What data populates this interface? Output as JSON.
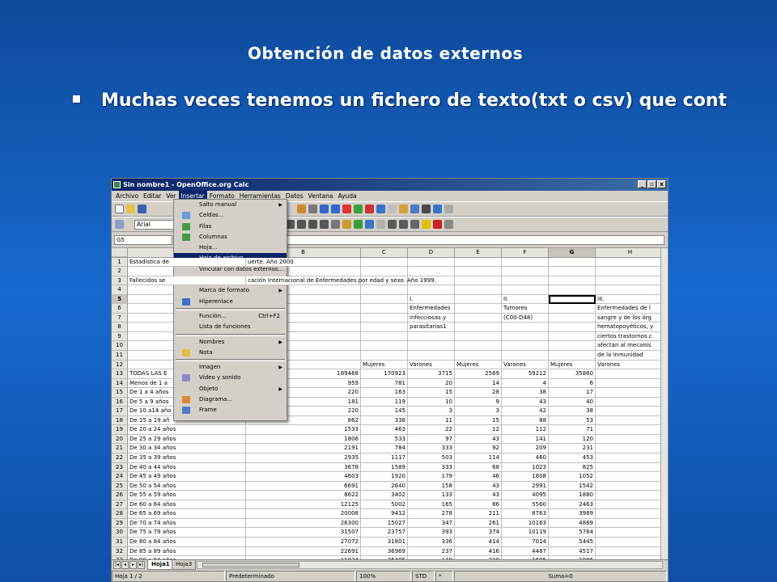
{
  "slide": {
    "title": "Obtención de datos externos",
    "bullet": "Muchas veces tenemos un fichero de texto(txt o csv) que cont"
  },
  "window": {
    "title": "Sin nombre1 - OpenOffice.org Calc",
    "menus": [
      "Archivo",
      "Editar",
      "Ver",
      "Insertar",
      "Formato",
      "Herramientas",
      "Datos",
      "Ventana",
      "Ayuda"
    ],
    "font_name": "Arial",
    "name_box": "G5"
  },
  "columns": [
    "A",
    "B",
    "C",
    "D",
    "E",
    "F",
    "G",
    "H"
  ],
  "rows": [
    {
      "n": "1",
      "a": "Estadística de",
      "b": "uerte. Año 2000"
    },
    {
      "n": "2"
    },
    {
      "n": "3",
      "a": "Fallecidos se",
      "b": "cación  Internacional de Enfermedades por edad y sexo. Año 1999."
    },
    {
      "n": "4"
    },
    {
      "n": "5",
      "b": "usas",
      "d": "I.",
      "f": "II.",
      "h": "III."
    },
    {
      "n": "6",
      "d": "Enfermedades",
      "f": "Tumores",
      "h": "Enfermedades de l"
    },
    {
      "n": "7",
      "d": "infecciosas y",
      "f": "(C00-D48)",
      "h": "sangre y de los órg"
    },
    {
      "n": "8",
      "d": "parasitarias1",
      "h": "hematopoyéticos, y"
    },
    {
      "n": "9",
      "h": "ciertos trastornos c"
    },
    {
      "n": "10",
      "h": "afectan al mecanis"
    },
    {
      "n": "11",
      "h": "de la inmunidad"
    },
    {
      "n": "12",
      "c": "Mujeres",
      "d": "Varones",
      "e": "Mujeres",
      "f": "Varones",
      "g": "Mujeres",
      "h": "Varones"
    },
    {
      "n": "13",
      "a": "TODAS LAS E",
      "b": "189468",
      "c": "170923",
      "d": "3715",
      "e": "2569",
      "f": "59212",
      "g": "35860"
    },
    {
      "n": "14",
      "a": "Menos de 1 a",
      "b": "959",
      "c": "781",
      "d": "20",
      "e": "14",
      "f": "4",
      "g": "6"
    },
    {
      "n": "15",
      "a": "De 1 a 4 años",
      "b": "220",
      "c": "163",
      "d": "15",
      "e": "28",
      "f": "38",
      "g": "17"
    },
    {
      "n": "16",
      "a": "De 5 a 9 años",
      "b": "181",
      "c": "119",
      "d": "10",
      "e": "9",
      "f": "43",
      "g": "40"
    },
    {
      "n": "17",
      "a": "De 10 a14 año",
      "b": "220",
      "c": "145",
      "d": "3",
      "e": "3",
      "f": "42",
      "g": "38"
    },
    {
      "n": "18",
      "a": "De 15 a 19 añ",
      "b": "862",
      "c": "336",
      "d": "11",
      "e": "15",
      "f": "88",
      "g": "53"
    },
    {
      "n": "19",
      "a": "De 20 a 24 años",
      "b": "1533",
      "c": "463",
      "d": "22",
      "e": "12",
      "f": "112",
      "g": "71"
    },
    {
      "n": "20",
      "a": "De 25 a 29 años",
      "b": "1806",
      "c": "533",
      "d": "97",
      "e": "43",
      "f": "141",
      "g": "120"
    },
    {
      "n": "21",
      "a": "De 30 a 34 años",
      "b": "2191",
      "c": "784",
      "d": "333",
      "e": "92",
      "f": "209",
      "g": "231"
    },
    {
      "n": "22",
      "a": "De 35 a 39 años",
      "b": "2935",
      "c": "1117",
      "d": "503",
      "e": "114",
      "f": "460",
      "g": "453"
    },
    {
      "n": "23",
      "a": "De 40 a 44 años",
      "b": "3678",
      "c": "1589",
      "d": "333",
      "e": "68",
      "f": "1023",
      "g": "825"
    },
    {
      "n": "24",
      "a": "De 45 a 49 años",
      "b": "4603",
      "c": "1920",
      "d": "179",
      "e": "46",
      "f": "1808",
      "g": "1052"
    },
    {
      "n": "25",
      "a": "De 50 a 54 años",
      "b": "6691",
      "c": "2640",
      "d": "158",
      "e": "43",
      "f": "2991",
      "g": "1542"
    },
    {
      "n": "26",
      "a": "De 55 a 59 años",
      "b": "8622",
      "c": "3402",
      "d": "133",
      "e": "43",
      "f": "4095",
      "g": "1880"
    },
    {
      "n": "27",
      "a": "De 60 a 64 años",
      "b": "12125",
      "c": "5002",
      "d": "165",
      "e": "86",
      "f": "5560",
      "g": "2463"
    },
    {
      "n": "28",
      "a": "De 65 a 69 años",
      "b": "20008",
      "c": "9412",
      "d": "278",
      "e": "211",
      "f": "8763",
      "g": "3989"
    },
    {
      "n": "29",
      "a": "De 70 a 74 años",
      "b": "26300",
      "c": "15027",
      "d": "347",
      "e": "261",
      "f": "10163",
      "g": "4889"
    },
    {
      "n": "30",
      "a": "De 75 a 79 años",
      "b": "31507",
      "c": "23757",
      "d": "393",
      "e": "374",
      "f": "10119",
      "g": "5764"
    },
    {
      "n": "31",
      "a": "De 80 a 84 años",
      "b": "27072",
      "c": "31801",
      "d": "336",
      "e": "414",
      "f": "7014",
      "g": "5445"
    },
    {
      "n": "32",
      "a": "De 85 a 89 años",
      "b": "22691",
      "c": "36969",
      "d": "237",
      "e": "416",
      "f": "4487",
      "g": "4517"
    },
    {
      "n": "33",
      "a": "De 90 a 94 años",
      "b": "11834",
      "c": "25485",
      "d": "119",
      "e": "210",
      "f": "1695",
      "g": "1986"
    }
  ],
  "menu_insertar": [
    {
      "label": "Salto manual",
      "arrow": true
    },
    {
      "label": "Celdas...",
      "icon": "cells-icon"
    },
    {
      "label": "Filas",
      "icon": "rows-icon"
    },
    {
      "label": "Columnas",
      "icon": "columns-icon"
    },
    {
      "label": "Hoja..."
    },
    {
      "label": "Hoja de archivo...",
      "highlight": true
    },
    {
      "label": "Vincular con datos externos..."
    },
    {
      "label": "Símbolos...",
      "icon": "symbols-icon"
    },
    {
      "label": "Marca de formato",
      "arrow": true
    },
    {
      "label": "Hiperenlace",
      "icon": "hyperlink-icon"
    },
    {
      "sep": true
    },
    {
      "label": "Función...",
      "shortcut": "Ctrl+F2"
    },
    {
      "label": "Lista de funciones"
    },
    {
      "sep": true
    },
    {
      "label": "Nombres",
      "arrow": true
    },
    {
      "label": "Nota",
      "icon": "note-icon"
    },
    {
      "sep": true
    },
    {
      "label": "Imagen",
      "arrow": true
    },
    {
      "label": "Vídeo y sonido",
      "icon": "video-icon"
    },
    {
      "label": "Objeto",
      "arrow": true
    },
    {
      "label": "Diagrama...",
      "icon": "chart-icon"
    },
    {
      "label": "Frame",
      "icon": "frame-icon"
    }
  ],
  "sheet_tabs": [
    "Hoja1",
    "Hoja3"
  ],
  "status": {
    "sheet": "Hoja 1 / 2",
    "style": "Predeterminado",
    "zoom": "100%",
    "mode": "STD",
    "modified": "*",
    "sum": "Suma=0"
  },
  "colors": {
    "titlebar": "#0a246a",
    "highlight": "#0a246a",
    "slide_bg": "#1769cf"
  }
}
